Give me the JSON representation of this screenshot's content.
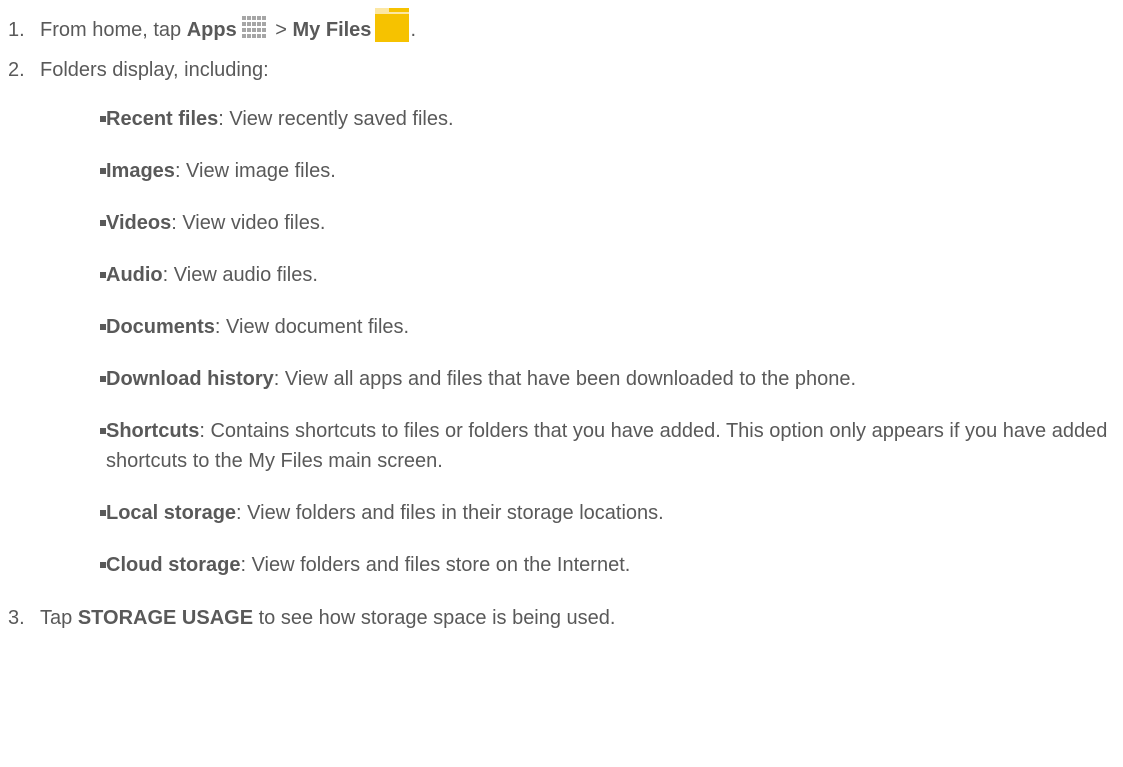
{
  "steps": [
    {
      "num": "1.",
      "text_prefix": "From home, tap ",
      "bold_1": "Apps",
      "sep": " > ",
      "bold_2": "My Files",
      "text_suffix": ".",
      "icons": [
        "apps-grid-icon",
        "folder-icon"
      ]
    },
    {
      "num": "2.",
      "text": "Folders display, including:"
    },
    {
      "num": "3.",
      "text_prefix": "Tap ",
      "bold": "STORAGE USAGE",
      "text_suffix": " to see how storage space is being used."
    }
  ],
  "folders": [
    {
      "name": "Recent files",
      "desc": ": View recently saved files."
    },
    {
      "name": "Images",
      "desc": ": View image files."
    },
    {
      "name": "Videos",
      "desc": ": View video files."
    },
    {
      "name": "Audio",
      "desc": ": View audio files."
    },
    {
      "name": "Documents",
      "desc": ": View document files."
    },
    {
      "name": "Download history",
      "desc": ": View all apps and files that have been downloaded to the phone."
    },
    {
      "name": "Shortcuts",
      "desc": ": Contains shortcuts to files or folders that you have added. This option only appears if you have added shortcuts to the My Files main screen."
    },
    {
      "name": "Local storage",
      "desc": ": View folders and files in their storage locations."
    },
    {
      "name": "Cloud storage",
      "desc": ": View folders and files store on the Internet."
    }
  ],
  "colors": {
    "text": "#595959",
    "apps_icon": "#a6a6a6",
    "folder_body": "#f6c200",
    "folder_tab": "#fce7a3"
  }
}
